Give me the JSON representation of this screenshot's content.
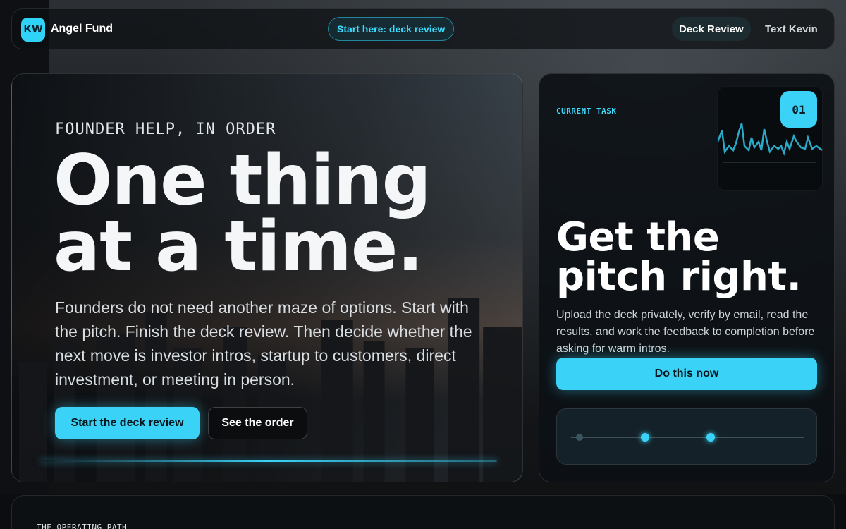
{
  "nav": {
    "logo": "KW",
    "brand": "Angel Fund",
    "start_pill": "Start here: deck review",
    "links": [
      "Deck Review",
      "Text Kevin"
    ]
  },
  "hero": {
    "eyebrow": "FOUNDER HELP, IN ORDER",
    "title_line1": "One thing",
    "title_line2": "at a time.",
    "body": "Founders do not need another maze of options. Start with the pitch. Finish the deck review. Then decide whether the next move is investor intros, startup to customers, direct investment, or meeting in person.",
    "primary_cta": "Start the deck review",
    "secondary_cta": "See the order"
  },
  "task": {
    "label": "CURRENT TASK",
    "number": "01",
    "title_line1": "Get the",
    "title_line2": "pitch right.",
    "body": "Upload the deck privately, verify by email, read the results, and work the feedback to completion before asking for warm intros.",
    "cta": "Do this now",
    "steps_total": 3,
    "steps_active": [
      false,
      true,
      true
    ]
  },
  "path": {
    "label": "THE OPERATING PATH"
  },
  "colors": {
    "accent": "#3ad3f7",
    "background": "#0b0d10"
  }
}
